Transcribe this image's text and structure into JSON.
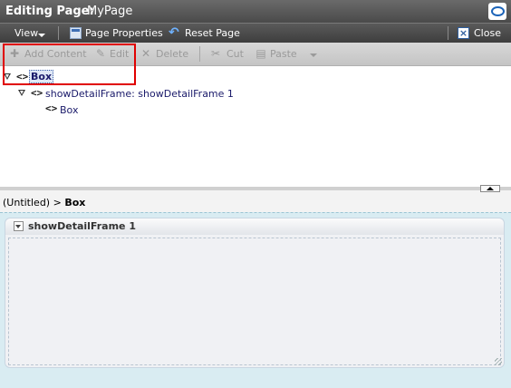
{
  "title": {
    "lead": "Editing Page:",
    "page_name": "MyPage"
  },
  "menu": {
    "view": "View",
    "page_properties": "Page Properties",
    "reset_page": "Reset Page",
    "close": "Close"
  },
  "toolbar": {
    "add_content": "Add Content",
    "edit": "Edit",
    "delete": "Delete",
    "cut": "Cut",
    "paste": "Paste"
  },
  "tree": {
    "nodes": [
      {
        "label": "Box",
        "selected": true
      },
      {
        "label": "showDetailFrame: showDetailFrame 1"
      },
      {
        "label": "Box"
      }
    ]
  },
  "breadcrumb": {
    "parent": "(Untitled)",
    "separator": ">",
    "current": "Box"
  },
  "frame": {
    "title": "showDetailFrame 1"
  },
  "colors": {
    "title_bar": "#555555",
    "toolbar": "#cccccc",
    "canvas": "#d9ecf2",
    "highlight": "#e00000"
  },
  "icons": {
    "oracle_logo": "oracle-logo-icon",
    "page_properties": "page-properties-icon",
    "reset": "reset-icon",
    "close": "close-icon"
  }
}
